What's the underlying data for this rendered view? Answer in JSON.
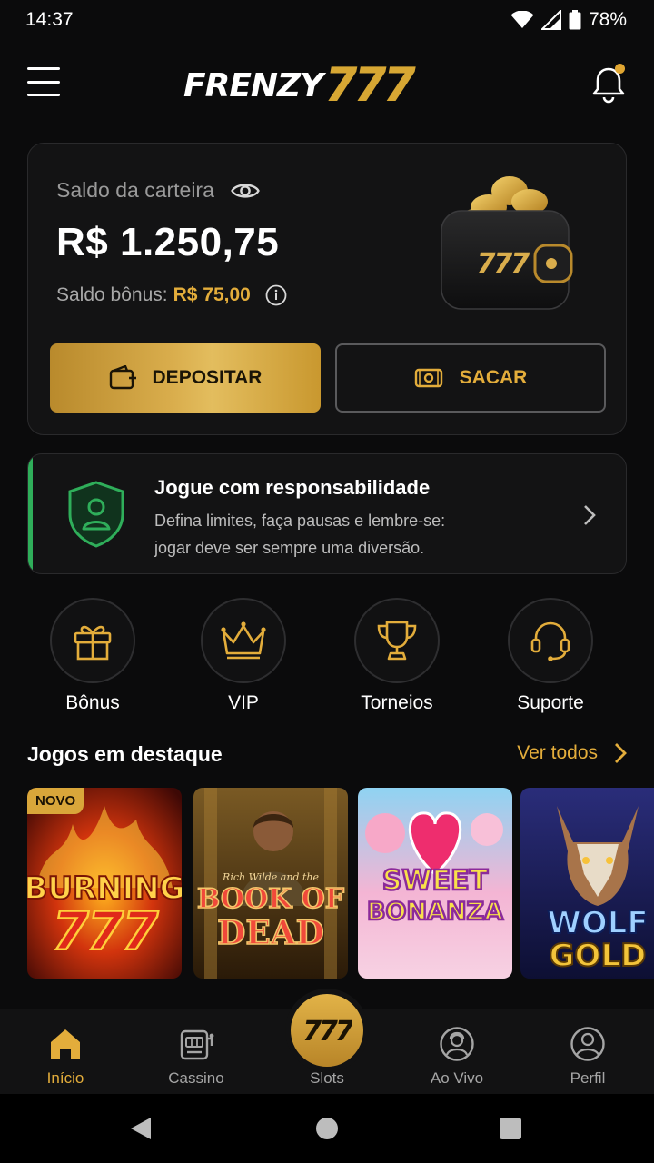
{
  "status_bar": {
    "time": "14:37",
    "battery": "78%"
  },
  "header": {
    "logo_text": "FRENZY",
    "logo_number": "777"
  },
  "wallet": {
    "label": "Saldo da carteira",
    "balance": "R$ 1.250,75",
    "bonus_label": "Saldo bônus:",
    "bonus_value": "R$ 75,00",
    "deposit_label": "DEPOSITAR",
    "withdraw_label": "SACAR",
    "illustration_text": "777"
  },
  "responsible": {
    "title": "Jogue com responsabilidade",
    "line1": "Defina limites, faça pausas e lembre-se:",
    "line2": "jogar deve ser sempre uma diversão."
  },
  "quick_actions": [
    {
      "label": "Bônus",
      "icon": "gift-icon"
    },
    {
      "label": "VIP",
      "icon": "crown-icon"
    },
    {
      "label": "Torneios",
      "icon": "trophy-icon"
    },
    {
      "label": "Suporte",
      "icon": "headset-icon"
    }
  ],
  "featured": {
    "title": "Jogos em destaque",
    "see_all": "Ver todos",
    "games": [
      {
        "line1": "BURNING",
        "line2": "777",
        "badge": "NOVO"
      },
      {
        "line0": "Rich Wilde and the",
        "line1": "BOOK OF",
        "line2": "DEAD"
      },
      {
        "line1": "SWEET",
        "line2": "BONANZA"
      },
      {
        "line1": "WOLF",
        "line2": "GOLD"
      }
    ]
  },
  "bottom_nav": {
    "items": [
      {
        "label": "Início",
        "icon": "home-icon"
      },
      {
        "label": "Cassino",
        "icon": "slot-machine-icon"
      },
      {
        "label": "Slots",
        "icon": "slots-777-icon",
        "fab_text": "777"
      },
      {
        "label": "Ao Vivo",
        "icon": "live-dealer-icon"
      },
      {
        "label": "Perfil",
        "icon": "profile-icon"
      }
    ],
    "active": "Início"
  },
  "colors": {
    "gold": "#e3ad3b",
    "green_accent": "#2fae5a",
    "background": "#0b0b0c"
  }
}
